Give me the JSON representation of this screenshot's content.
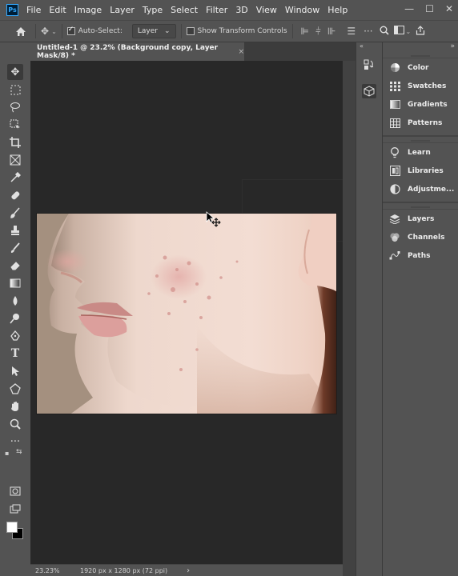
{
  "app": {
    "logo": "Ps",
    "menu": [
      "File",
      "Edit",
      "Image",
      "Layer",
      "Type",
      "Select",
      "Filter",
      "3D",
      "View",
      "Window",
      "Help"
    ],
    "window_controls": {
      "minimize": "—",
      "maximize": "☐",
      "close": "✕"
    }
  },
  "options_bar": {
    "auto_select_label": "Auto-Select:",
    "auto_select_checked": true,
    "auto_select_target": "Layer",
    "transform_controls_label": "Show Transform Controls",
    "transform_controls_checked": false
  },
  "document": {
    "tab_title": "Untitled-1 @ 23.2% (Background copy, Layer Mask/8) *",
    "tab_close": "×",
    "zoom": "23.23%",
    "doc_info": "1920 px x 1280 px (72 ppi)",
    "status_arrow": "›"
  },
  "panels": {
    "group1": [
      {
        "label": "Color",
        "icon": "color-wheel-icon"
      },
      {
        "label": "Swatches",
        "icon": "grid-icon"
      },
      {
        "label": "Gradients",
        "icon": "gradient-icon"
      },
      {
        "label": "Patterns",
        "icon": "pattern-icon"
      }
    ],
    "group2": [
      {
        "label": "Learn",
        "icon": "lightbulb-icon"
      },
      {
        "label": "Libraries",
        "icon": "libraries-icon"
      },
      {
        "label": "Adjustme...",
        "icon": "adjustments-icon"
      }
    ],
    "group3": [
      {
        "label": "Layers",
        "icon": "layers-icon"
      },
      {
        "label": "Channels",
        "icon": "channels-icon"
      },
      {
        "label": "Paths",
        "icon": "paths-icon"
      }
    ]
  },
  "colors": {
    "foreground": "#ffffff",
    "background": "#000000",
    "ui_bg": "#535353",
    "canvas_bg": "#282828"
  }
}
